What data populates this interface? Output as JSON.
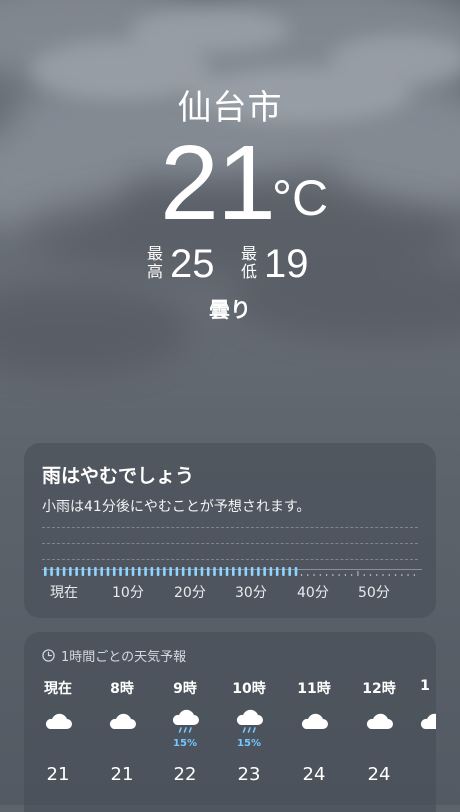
{
  "location": {
    "city": "仙台市"
  },
  "current": {
    "temperature": "21",
    "unit": "°C",
    "high_label": "最高",
    "high": "25",
    "low_label": "最低",
    "low": "19",
    "condition": "曇り"
  },
  "rain_card": {
    "title": "雨はやむでしょう",
    "subtitle": "小雨は41分後にやむことが予想されます。",
    "tick_labels": [
      "現在",
      "10分",
      "20分",
      "30分",
      "40分",
      "50分"
    ],
    "rain_minutes": 41,
    "total_minutes": 60,
    "bar_color": "#8fd3ff"
  },
  "hourly": {
    "title": "1時間ごとの天気予報",
    "icon": "clock-icon",
    "items": [
      {
        "time": "現在",
        "icon": "cloud-icon",
        "prob": "",
        "temp": "21"
      },
      {
        "time": "8時",
        "icon": "cloud-icon",
        "prob": "",
        "temp": "21"
      },
      {
        "time": "9時",
        "icon": "cloud-rain-icon",
        "prob": "15%",
        "temp": "22"
      },
      {
        "time": "10時",
        "icon": "cloud-rain-icon",
        "prob": "15%",
        "temp": "23"
      },
      {
        "time": "11時",
        "icon": "cloud-icon",
        "prob": "",
        "temp": "24"
      },
      {
        "time": "12時",
        "icon": "cloud-icon",
        "prob": "",
        "temp": "24"
      },
      {
        "time": "1",
        "icon": "cloud-icon",
        "prob": "",
        "temp": ""
      }
    ],
    "rain_color": "#73c6ff"
  }
}
